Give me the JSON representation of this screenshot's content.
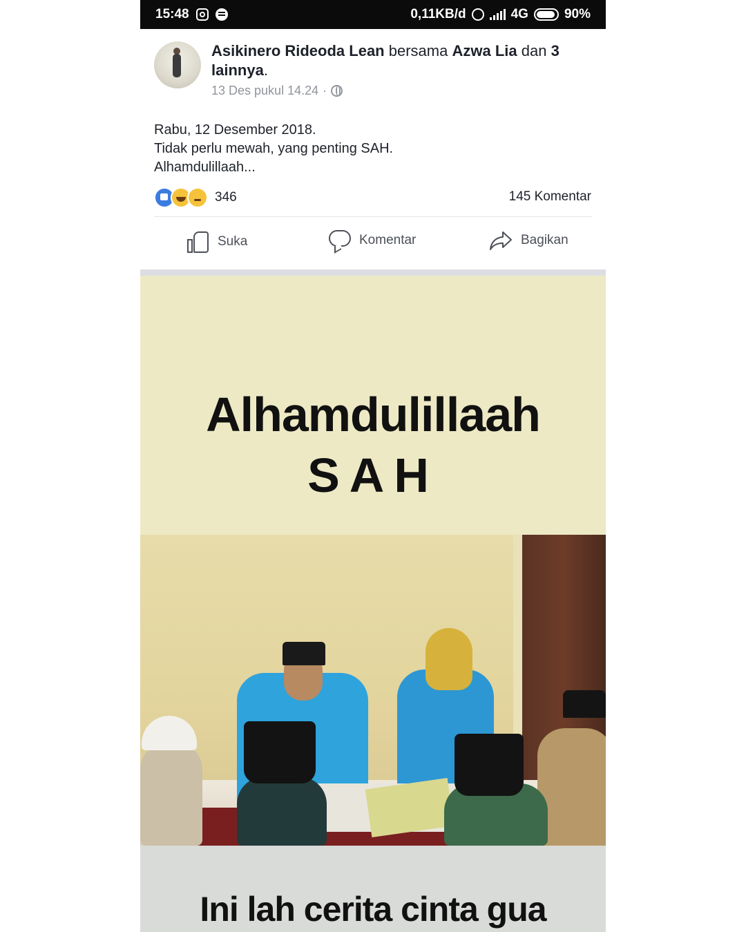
{
  "status_bar": {
    "time": "15:48",
    "net_speed": "0,11KB/d",
    "network": "4G",
    "battery": "90%",
    "icons": [
      "instagram-icon",
      "spotify-icon",
      "alarm-icon",
      "signal-icon",
      "battery-icon"
    ]
  },
  "post": {
    "author": "Asikinero Rideoda Lean",
    "with_word": "bersama",
    "tagged": "Azwa Lia",
    "and_word": "dan",
    "others": "3 lainnya",
    "period": ".",
    "timestamp": "13 Des pukul 14.24",
    "separator": "·",
    "privacy_icon": "globe-icon",
    "lines": [
      "Rabu, 12 Desember 2018.",
      "Tidak perlu mewah, yang penting SAH.",
      "Alhamdulillaah..."
    ],
    "reaction_count": "346",
    "comment_count": "145 Komentar"
  },
  "actions": {
    "like": "Suka",
    "comment": "Komentar",
    "share": "Bagikan"
  },
  "image": {
    "title": "Alhamdulillaah",
    "subtitle": "SAH",
    "caption": "Ini lah cerita cinta gua"
  },
  "colors": {
    "status_bar_bg": "#0b0b0b",
    "like_blue": "#3b7ce0",
    "banner_bg": "#ede9c4",
    "caption_bg": "#d9dbd8",
    "text_dark": "#1d2129",
    "text_muted": "#90949c"
  }
}
